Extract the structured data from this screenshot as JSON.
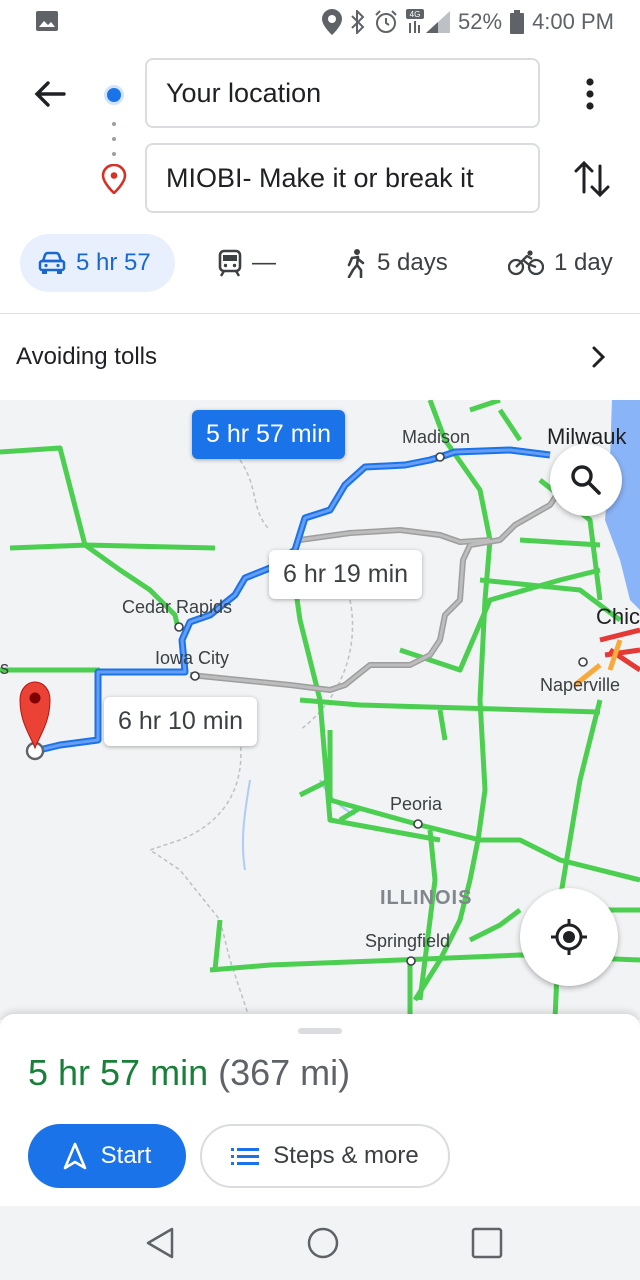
{
  "status_bar": {
    "battery": "52%",
    "time": "4:00 PM",
    "network": "4G",
    "icons": [
      "image-icon",
      "location-icon",
      "bluetooth-icon",
      "alarm-icon",
      "signal-icon",
      "battery-icon"
    ]
  },
  "directions": {
    "from_value": "Your location",
    "to_value": "MIOBI- Make it or break it"
  },
  "modes": [
    {
      "icon": "car-icon",
      "label": "5 hr 57",
      "active": true
    },
    {
      "icon": "transit-icon",
      "label": "—",
      "active": false
    },
    {
      "icon": "walk-icon",
      "label": "5 days",
      "active": false
    },
    {
      "icon": "bike-icon",
      "label": "1 day",
      "active": false
    }
  ],
  "options": {
    "tolls_label": "Avoiding tolls"
  },
  "map": {
    "cities": {
      "madison": "Madison",
      "milwaukee": "Milwauk",
      "cedar_rapids": "Cedar Rapids",
      "iowa_city": "Iowa City",
      "naperville": "Naperville",
      "chicago": "Chic",
      "peoria": "Peoria",
      "illinois": "ILLINOIS",
      "springfield": "Springfield",
      "edge_s": "s"
    },
    "routes": {
      "primary": "5 hr 57 min",
      "alt1": "6 hr 19 min",
      "alt2": "6 hr 10 min"
    },
    "colors": {
      "primary_route": "#4285f4",
      "alt_route": "#9e9e9e",
      "traffic_good": "#4ccf50",
      "traffic_slow": "#f7a93b",
      "traffic_heavy": "#e53935"
    }
  },
  "summary": {
    "duration": "5 hr 57 min",
    "distance": "(367 mi)"
  },
  "buttons": {
    "start": "Start",
    "steps": "Steps & more"
  }
}
